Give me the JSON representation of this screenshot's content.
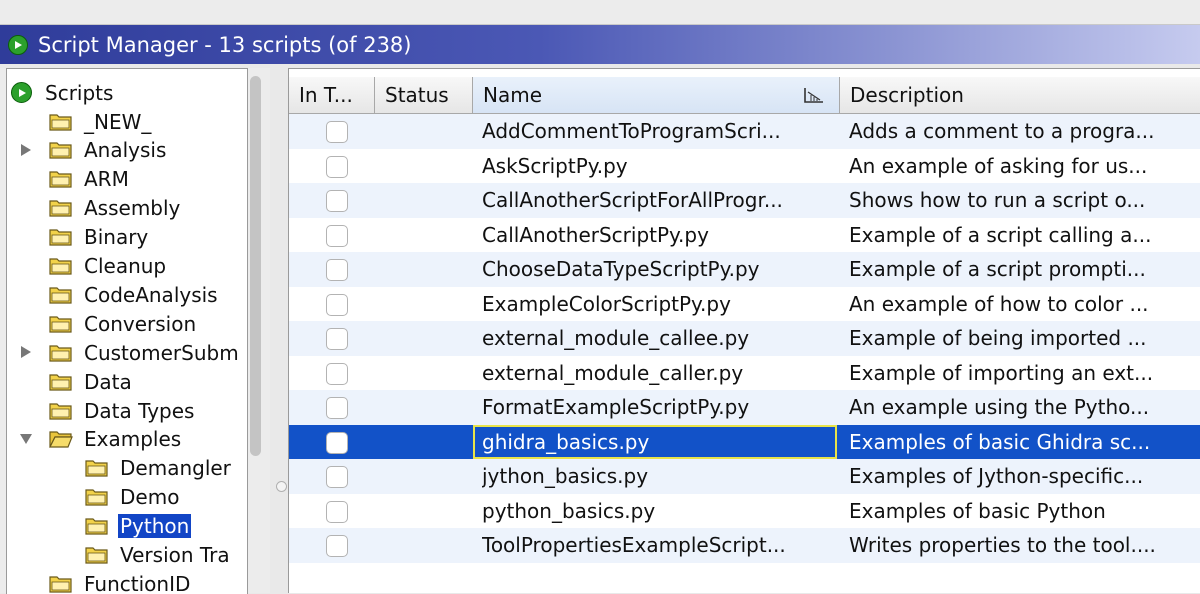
{
  "window": {
    "title": "Script Manager - 13 scripts  (of 238)"
  },
  "tree": {
    "root_label": "Scripts",
    "items": [
      {
        "label": "_NEW_",
        "expander": "none",
        "level": 1
      },
      {
        "label": "Analysis",
        "expander": "collapsed",
        "level": 1
      },
      {
        "label": "ARM",
        "expander": "none",
        "level": 1
      },
      {
        "label": "Assembly",
        "expander": "none",
        "level": 1
      },
      {
        "label": "Binary",
        "expander": "none",
        "level": 1
      },
      {
        "label": "Cleanup",
        "expander": "none",
        "level": 1
      },
      {
        "label": "CodeAnalysis",
        "expander": "none",
        "level": 1
      },
      {
        "label": "Conversion",
        "expander": "none",
        "level": 1
      },
      {
        "label": "CustomerSubm",
        "expander": "collapsed",
        "level": 1
      },
      {
        "label": "Data",
        "expander": "none",
        "level": 1
      },
      {
        "label": "Data Types",
        "expander": "none",
        "level": 1
      },
      {
        "label": "Examples",
        "expander": "expanded",
        "level": 1
      },
      {
        "label": "Demangler",
        "expander": "none",
        "level": 2
      },
      {
        "label": "Demo",
        "expander": "none",
        "level": 2
      },
      {
        "label": "Python",
        "expander": "none",
        "level": 2,
        "selected": true
      },
      {
        "label": "Version Tra",
        "expander": "none",
        "level": 2
      },
      {
        "label": "FunctionID",
        "expander": "none",
        "level": 1
      }
    ]
  },
  "table": {
    "columns": [
      "In T...",
      "Status",
      "Name",
      "Description"
    ],
    "rows": [
      {
        "name": "AddCommentToProgramScri...",
        "description": "Adds a comment to a progra..."
      },
      {
        "name": "AskScriptPy.py",
        "description": "An example of asking for us..."
      },
      {
        "name": "CallAnotherScriptForAllProgr...",
        "description": "Shows how to run a script o..."
      },
      {
        "name": "CallAnotherScriptPy.py",
        "description": "Example of a script calling a..."
      },
      {
        "name": "ChooseDataTypeScriptPy.py",
        "description": "Example of a script prompti..."
      },
      {
        "name": "ExampleColorScriptPy.py",
        "description": "An example of how to color ..."
      },
      {
        "name": "external_module_callee.py",
        "description": "Example of being imported ..."
      },
      {
        "name": "external_module_caller.py",
        "description": "Example of importing an ext..."
      },
      {
        "name": "FormatExampleScriptPy.py",
        "description": "An example using the Pytho..."
      },
      {
        "name": "ghidra_basics.py",
        "description": "Examples of basic Ghidra sc...",
        "selected": true
      },
      {
        "name": "jython_basics.py",
        "description": "Examples of Jython-specific..."
      },
      {
        "name": "python_basics.py",
        "description": "Examples of basic Python"
      },
      {
        "name": "ToolPropertiesExampleScript...",
        "description": "Writes properties to the tool...."
      }
    ]
  },
  "colors": {
    "title_gradient_start": "#2f3c9a",
    "selection": "#1252c8",
    "alt_row": "#edf3fc",
    "run_green": "#2ca02c",
    "folder_yellow": "#f2d24a"
  }
}
